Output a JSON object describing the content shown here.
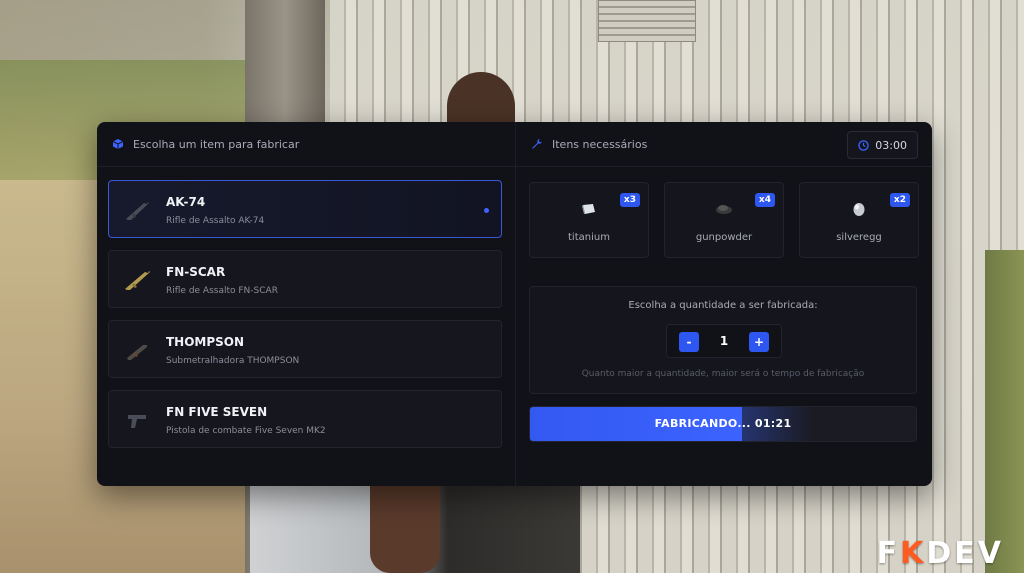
{
  "branding": {
    "logo_left": "F",
    "logo_k": "K",
    "logo_right": "DEV"
  },
  "left_panel": {
    "header": "Escolha um item para fabricar",
    "header_icon": "cube-icon",
    "items": [
      {
        "name": "AK-74",
        "description": "Rifle de Assalto AK-74",
        "selected": true,
        "icon": "rifle-icon"
      },
      {
        "name": "FN-SCAR",
        "description": "Rifle de Assalto FN-SCAR",
        "selected": false,
        "icon": "rifle-icon"
      },
      {
        "name": "THOMPSON",
        "description": "Submetralhadora THOMPSON",
        "selected": false,
        "icon": "smg-icon"
      },
      {
        "name": "FN FIVE SEVEN",
        "description": "Pistola de combate Five Seven MK2",
        "selected": false,
        "icon": "pistol-icon"
      }
    ]
  },
  "right_panel": {
    "header": "Itens necessários",
    "header_icon": "wrench-icon",
    "timer": "03:00",
    "timer_icon": "clock-icon",
    "requirements": [
      {
        "label": "titanium",
        "amount": "x3",
        "icon": "titanium-icon"
      },
      {
        "label": "gunpowder",
        "amount": "x4",
        "icon": "gunpowder-icon"
      },
      {
        "label": "silveregg",
        "amount": "x2",
        "icon": "silveregg-icon"
      }
    ],
    "quantity": {
      "title": "Escolha a quantidade a ser fabricada:",
      "minus_label": "-",
      "value": "1",
      "plus_label": "+",
      "hint": "Quanto maior a quantidade, maior será o tempo de fabricação"
    },
    "progress": {
      "text": "FABRICANDO... 01:21",
      "percent": 55
    }
  },
  "colors": {
    "accent": "#3d63ff",
    "panel_bg": "#111118",
    "logo_accent": "#ff5a1f"
  }
}
